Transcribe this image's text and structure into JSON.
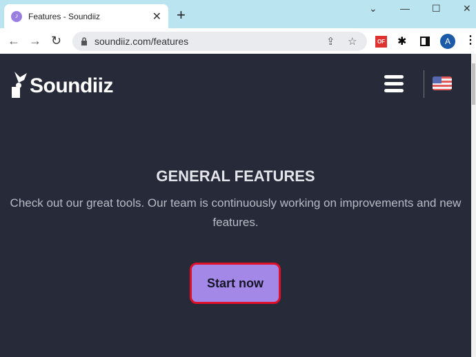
{
  "browser": {
    "tab_title": "Features - Soundiiz",
    "url": "soundiiz.com/features",
    "profile_initial": "A",
    "ext_label": "OF"
  },
  "site": {
    "logo_text": "Soundiiz",
    "heading": "GENERAL FEATURES",
    "subtitle": "Check out our great tools. Our team is continuously working on improvements and new features.",
    "cta": "Start now"
  },
  "colors": {
    "accent": "#a388e8",
    "button_border": "#e0102a",
    "background": "#272a38"
  }
}
